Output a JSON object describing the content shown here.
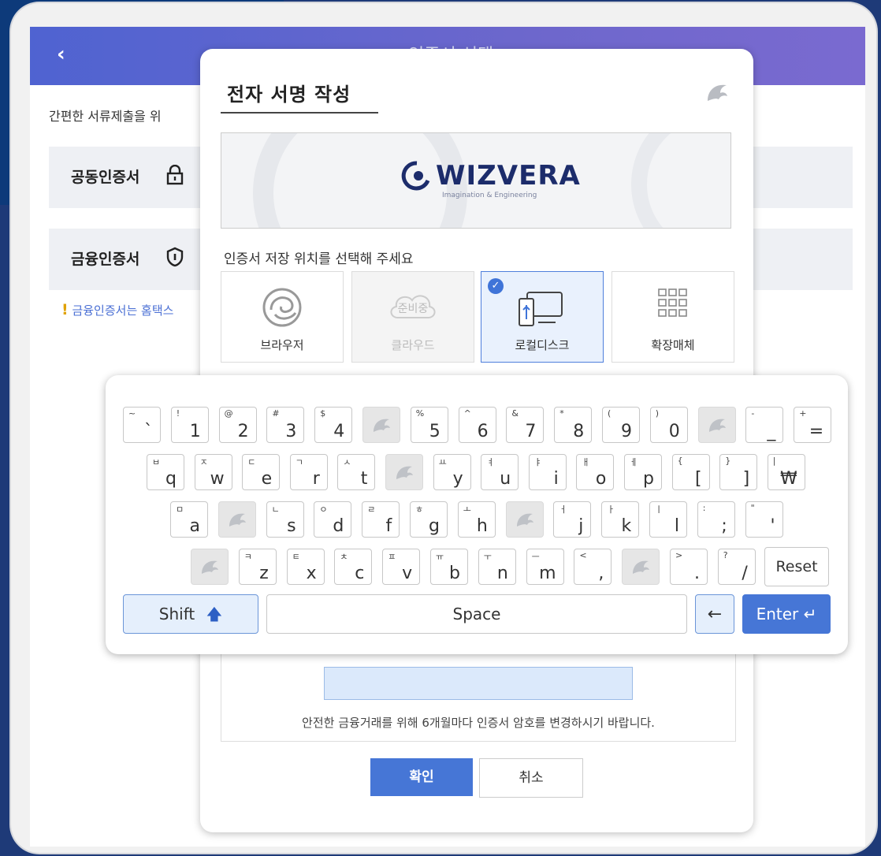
{
  "app": {
    "title": "인증서 선택",
    "back_icon": "chevron-left-icon",
    "intro_text": "간편한 서류제출을 위",
    "cert_rows": [
      {
        "label": "공동인증서",
        "icon": "lock-icon"
      },
      {
        "label": "금융인증서",
        "icon": "shield-icon"
      }
    ],
    "notice_mark": "!",
    "notice_text": "금융인증서는 홈택스"
  },
  "dialog": {
    "title": "전자 서명 작성",
    "logo_icon": "dolphin-logo-icon",
    "brand": {
      "name": "WIZVERA",
      "tagline": "Imagination & Engineering"
    },
    "location_label": "인증서 저장 위치를 선택해 주세요",
    "locations": [
      {
        "name": "브라우저",
        "icon": "browser-icon",
        "state": "normal"
      },
      {
        "name": "클라우드",
        "icon": "cloud-icon",
        "badge": "준비중",
        "state": "disabled"
      },
      {
        "name": "로컬디스크",
        "icon": "local-disk-icon",
        "state": "selected"
      },
      {
        "name": "확장매체",
        "icon": "grid-icon",
        "state": "normal"
      }
    ],
    "password_note": "안전한 금융거래를 위해 6개월마다 인증서 암호를 변경하시기 바랍니다.",
    "ok_label": "확인",
    "cancel_label": "취소"
  },
  "keyboard": {
    "rows": [
      [
        {
          "s": "~",
          "m": "`"
        },
        {
          "s": "!",
          "m": "1"
        },
        {
          "s": "@",
          "m": "2"
        },
        {
          "s": "#",
          "m": "3"
        },
        {
          "s": "$",
          "m": "4"
        },
        {
          "blank": true
        },
        {
          "s": "%",
          "m": "5"
        },
        {
          "s": "^",
          "m": "6"
        },
        {
          "s": "&",
          "m": "7"
        },
        {
          "s": "*",
          "m": "8"
        },
        {
          "s": "(",
          "m": "9"
        },
        {
          "s": ")",
          "m": "0"
        },
        {
          "blank": true
        },
        {
          "s": "-",
          "m": "_"
        },
        {
          "s": "+",
          "m": "="
        }
      ],
      [
        {
          "s": "ㅂ",
          "m": "q"
        },
        {
          "s": "ㅈ",
          "m": "w"
        },
        {
          "s": "ㄷ",
          "m": "e"
        },
        {
          "s": "ㄱ",
          "m": "r"
        },
        {
          "s": "ㅅ",
          "m": "t"
        },
        {
          "blank": true
        },
        {
          "s": "ㅛ",
          "m": "y"
        },
        {
          "s": "ㅕ",
          "m": "u"
        },
        {
          "s": "ㅑ",
          "m": "i"
        },
        {
          "s": "ㅐ",
          "m": "o"
        },
        {
          "s": "ㅔ",
          "m": "p"
        },
        {
          "s": "{",
          "m": "["
        },
        {
          "s": "}",
          "m": "]"
        },
        {
          "s": "|",
          "m": "₩"
        }
      ],
      [
        {
          "s": "ㅁ",
          "m": "a"
        },
        {
          "blank": true
        },
        {
          "s": "ㄴ",
          "m": "s"
        },
        {
          "s": "ㅇ",
          "m": "d"
        },
        {
          "s": "ㄹ",
          "m": "f"
        },
        {
          "s": "ㅎ",
          "m": "g"
        },
        {
          "s": "ㅗ",
          "m": "h"
        },
        {
          "blank": true
        },
        {
          "s": "ㅓ",
          "m": "j"
        },
        {
          "s": "ㅏ",
          "m": "k"
        },
        {
          "s": "ㅣ",
          "m": "l"
        },
        {
          "s": ":",
          "m": ";"
        },
        {
          "s": "\"",
          "m": "'"
        }
      ],
      [
        {
          "blank": true
        },
        {
          "s": "ㅋ",
          "m": "z"
        },
        {
          "s": "ㅌ",
          "m": "x"
        },
        {
          "s": "ㅊ",
          "m": "c"
        },
        {
          "s": "ㅍ",
          "m": "v"
        },
        {
          "s": "ㅠ",
          "m": "b"
        },
        {
          "s": "ㅜ",
          "m": "n"
        },
        {
          "s": "ㅡ",
          "m": "m"
        },
        {
          "s": "<",
          "m": ","
        },
        {
          "blank": true
        },
        {
          "s": ">",
          "m": "."
        },
        {
          "s": "?",
          "m": "/"
        }
      ]
    ],
    "reset_label": "Reset",
    "shift_label": "Shift",
    "shift_icon": "arrow-up-icon",
    "space_label": "Space",
    "backspace_icon": "arrow-left-icon",
    "enter_label": "Enter",
    "enter_icon": "enter-icon",
    "blank_icon": "dolphin-icon"
  }
}
